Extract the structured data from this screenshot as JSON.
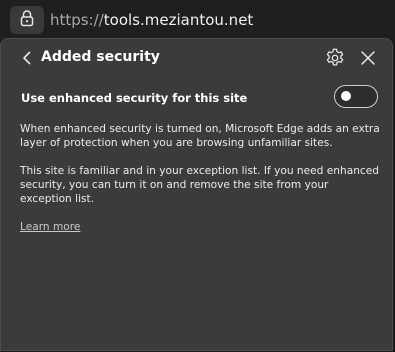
{
  "address_bar": {
    "lock_icon": "lock-icon",
    "url_scheme": "https://",
    "url_host": "tools.meziantou.net"
  },
  "panel": {
    "back_icon": "chevron-left-icon",
    "title": "Added security",
    "settings_icon": "gear-icon",
    "close_icon": "close-icon",
    "toggle": {
      "label": "Use enhanced security for this site",
      "state": "off"
    },
    "description_1": "When enhanced security is turned on, Microsoft Edge adds an extra layer of protection when you are browsing unfamiliar sites.",
    "description_2": "This site is familiar and in your exception list. If you need enhanced security, you can turn it on and remove the site from your exception list.",
    "learn_more": "Learn more"
  },
  "colors": {
    "panel_bg": "#3b3b3b",
    "page_bg": "#1f1f1f",
    "text": "#ffffff",
    "url_scheme": "#a8a8a8"
  }
}
